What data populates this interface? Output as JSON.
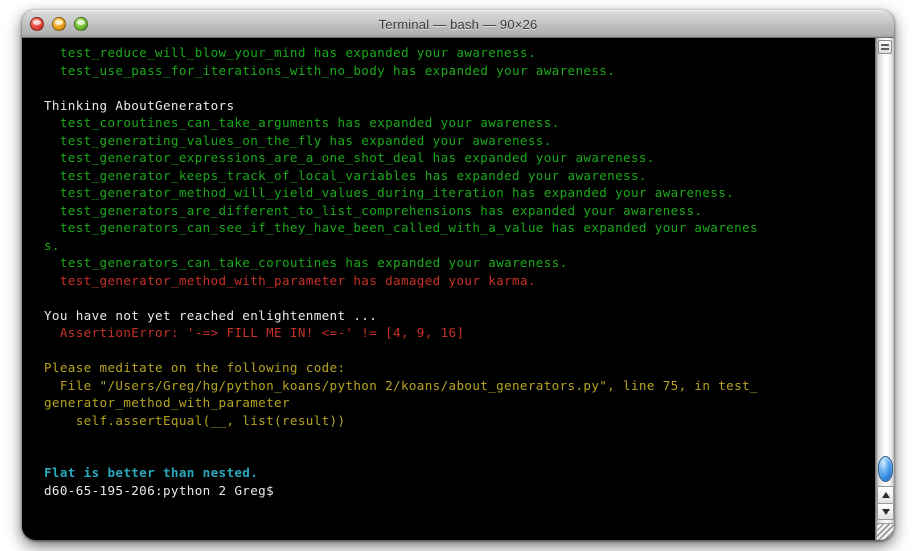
{
  "window": {
    "title": "Terminal — bash — 90×26",
    "controls": {
      "close": "close-button",
      "minimize": "minimize-button",
      "zoom": "zoom-button"
    }
  },
  "colors": {
    "background": "#000000",
    "green": "#1aa81a",
    "red": "#c63128",
    "white": "#e9e9e9",
    "yellow": "#b5a321",
    "cyan": "#29a8bd",
    "titlebar": "#c6c6c6"
  },
  "terminal": {
    "lines": [
      {
        "text": "  test_reduce_will_blow_your_mind has expanded your awareness.",
        "color": "green"
      },
      {
        "text": "  test_use_pass_for_iterations_with_no_body has expanded your awareness.",
        "color": "green"
      },
      {
        "text": "",
        "color": "blank"
      },
      {
        "text": "Thinking AboutGenerators",
        "color": "white"
      },
      {
        "text": "  test_coroutines_can_take_arguments has expanded your awareness.",
        "color": "green"
      },
      {
        "text": "  test_generating_values_on_the_fly has expanded your awareness.",
        "color": "green"
      },
      {
        "text": "  test_generator_expressions_are_a_one_shot_deal has expanded your awareness.",
        "color": "green"
      },
      {
        "text": "  test_generator_keeps_track_of_local_variables has expanded your awareness.",
        "color": "green"
      },
      {
        "text": "  test_generator_method_will_yield_values_during_iteration has expanded your awareness.",
        "color": "green"
      },
      {
        "text": "  test_generators_are_different_to_list_comprehensions has expanded your awareness.",
        "color": "green"
      },
      {
        "text": "  test_generators_can_see_if_they_have_been_called_with_a_value has expanded your awarenes",
        "color": "green"
      },
      {
        "text": "s.",
        "color": "green"
      },
      {
        "text": "  test_generators_can_take_coroutines has expanded your awareness.",
        "color": "green"
      },
      {
        "text": "  test_generator_method_with_parameter has damaged your karma.",
        "color": "red"
      },
      {
        "text": "",
        "color": "blank"
      },
      {
        "text": "You have not yet reached enlightenment ...",
        "color": "white"
      },
      {
        "text": "  AssertionError: '-=> FILL ME IN! <=-' != [4, 9, 16]",
        "color": "red"
      },
      {
        "text": "",
        "color": "blank"
      },
      {
        "text": "Please meditate on the following code:",
        "color": "yellow"
      },
      {
        "text": "  File \"/Users/Greg/hg/python_koans/python 2/koans/about_generators.py\", line 75, in test_",
        "color": "yellow"
      },
      {
        "text": "generator_method_with_parameter",
        "color": "yellow"
      },
      {
        "text": "    self.assertEqual(__, list(result))",
        "color": "yellow"
      },
      {
        "text": "",
        "color": "blank"
      },
      {
        "text": "",
        "color": "blank"
      },
      {
        "text": "Flat is better than nested.",
        "color": "cyan"
      },
      {
        "text": "d60-65-195-206:python 2 Greg$",
        "color": "white"
      }
    ]
  },
  "scrollbar": {
    "grip_label": "scrollbar-grip",
    "up_arrow": "scroll-up",
    "down_arrow": "scroll-down",
    "resize": "resize-grip"
  }
}
